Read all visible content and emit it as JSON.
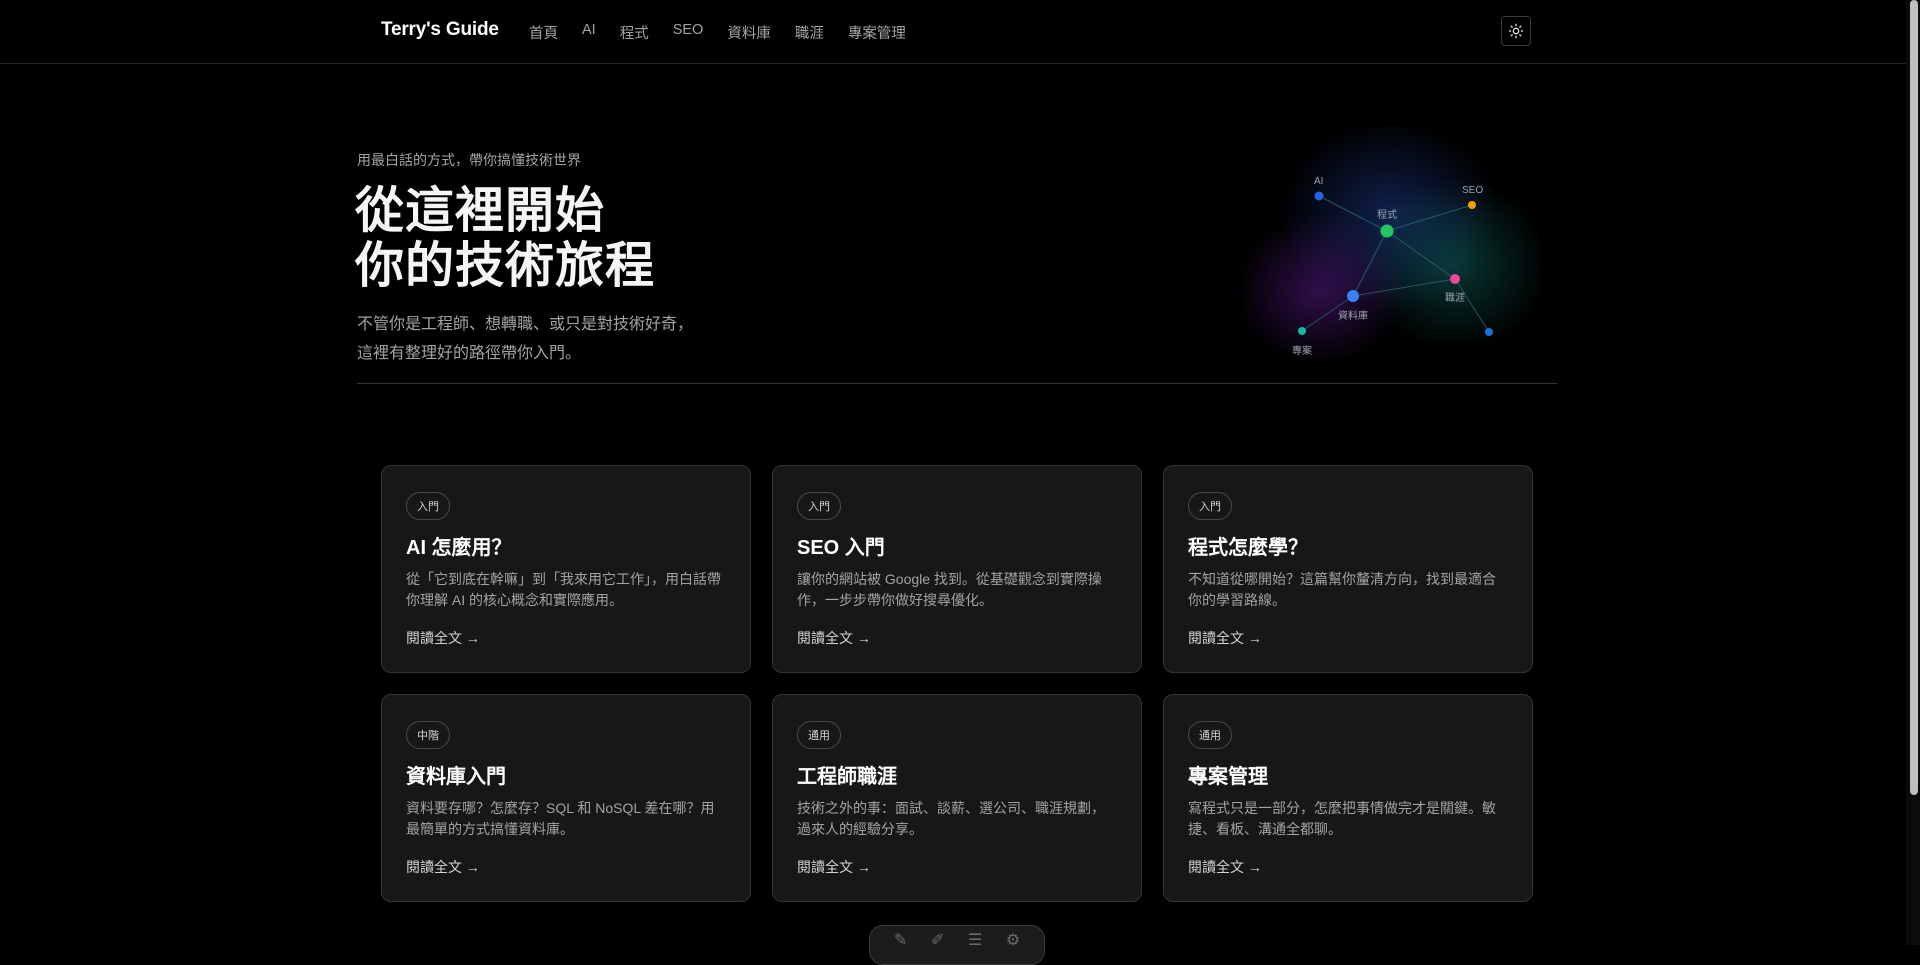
{
  "site": {
    "logo": "Terry's Guide",
    "nav": [
      "首頁",
      "AI",
      "程式",
      "SEO",
      "資料庫",
      "職涯",
      "專案管理"
    ]
  },
  "theme_toggle": {
    "icon": "sun-icon"
  },
  "hero": {
    "kicker": "用最白話的方式，帶你搞懂技術世界",
    "title_line1": "從這裡開始",
    "title_line2": "你的技術旅程",
    "desc_line1": "不管你是工程師、想轉職、或只是對技術好奇，",
    "desc_line2": "這裡有整理好的路徑帶你入門。"
  },
  "graph": {
    "labels": {
      "ai": "AI",
      "code": "程式",
      "seo": "SEO",
      "career": "職涯",
      "database": "資料庫",
      "project": "專案"
    },
    "colors": {
      "ai": "#2563eb",
      "code": "#22c55e",
      "seo": "#f59e0b",
      "career": "#ec4899",
      "database": "#3b82f6",
      "project": "#14b8a6",
      "extra": "#1d6fe0"
    }
  },
  "cards": [
    {
      "badge": "入門",
      "title": "AI 怎麼用？",
      "desc": "從「它到底在幹嘛」到「我來用它工作」，用白話帶你理解 AI 的核心概念和實際應用。",
      "link": "閱讀全文 →"
    },
    {
      "badge": "入門",
      "title": "SEO 入門",
      "desc": "讓你的網站被 Google 找到。從基礎觀念到實際操作，一步步帶你做好搜尋優化。",
      "link": "閱讀全文 →"
    },
    {
      "badge": "入門",
      "title": "程式怎麼學？",
      "desc": "不知道從哪開始？這篇幫你釐清方向，找到最適合你的學習路線。",
      "link": "閱讀全文 →"
    },
    {
      "badge": "中階",
      "title": "資料庫入門",
      "desc": "資料要存哪？怎麼存？SQL 和 NoSQL 差在哪？用最簡單的方式搞懂資料庫。",
      "link": "閱讀全文 →"
    },
    {
      "badge": "通用",
      "title": "工程師職涯",
      "desc": "技術之外的事：面試、談薪、選公司、職涯規劃，過來人的經驗分享。",
      "link": "閱讀全文 →"
    },
    {
      "badge": "通用",
      "title": "專案管理",
      "desc": "寫程式只是一部分，怎麼把事情做完才是關鍵。敏捷、看板、溝通全都聊。",
      "link": "閱讀全文 →"
    }
  ],
  "toolbar": {
    "icons": [
      "pen-icon",
      "highlighter-icon",
      "list-icon",
      "settings-icon"
    ]
  }
}
